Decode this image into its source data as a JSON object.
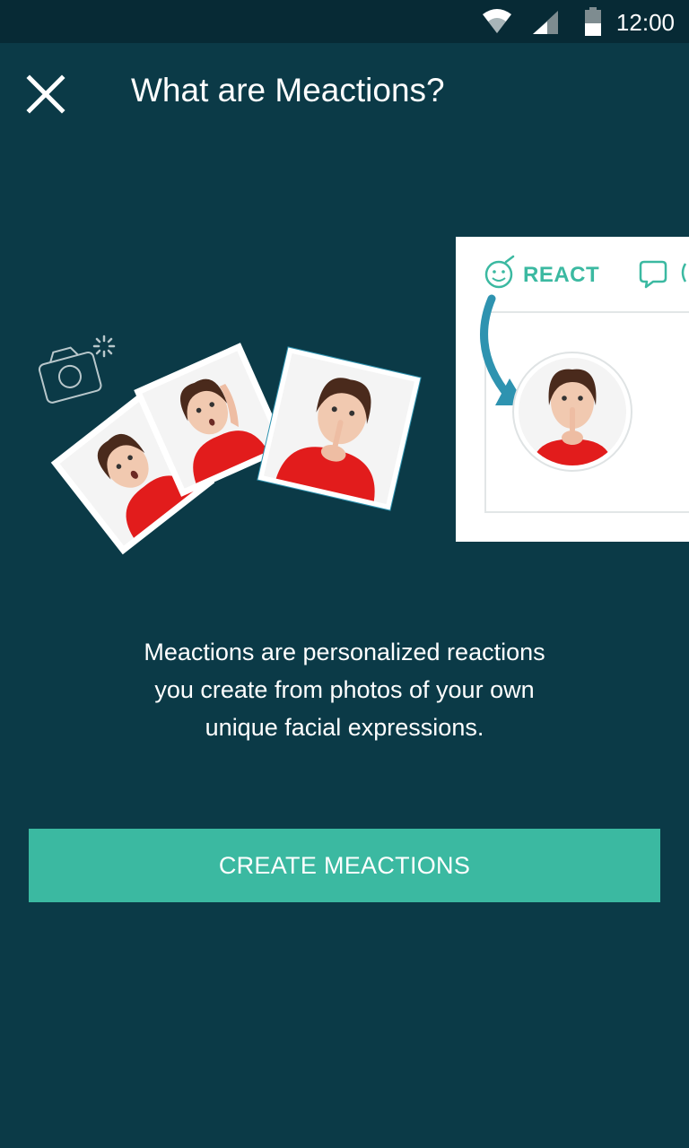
{
  "status_bar": {
    "time": "12:00",
    "icons": [
      "wifi-icon",
      "cell-signal-icon",
      "battery-icon"
    ]
  },
  "header": {
    "close_icon": "close-icon",
    "title": "What are Meactions?"
  },
  "illustration": {
    "react_label": "REACT",
    "icons": [
      "camera-icon",
      "smiley-icon",
      "chat-bubble-icon",
      "curved-arrow-icon"
    ]
  },
  "description": {
    "line1": "Meactions are personalized reactions",
    "line2": "you create from photos of your own",
    "line3": "unique facial expressions."
  },
  "cta": {
    "label": "CREATE MEACTIONS"
  },
  "colors": {
    "background": "#0b3a47",
    "status_bar": "#072a35",
    "accent": "#3bb9a1",
    "arrow": "#2e93b0"
  }
}
